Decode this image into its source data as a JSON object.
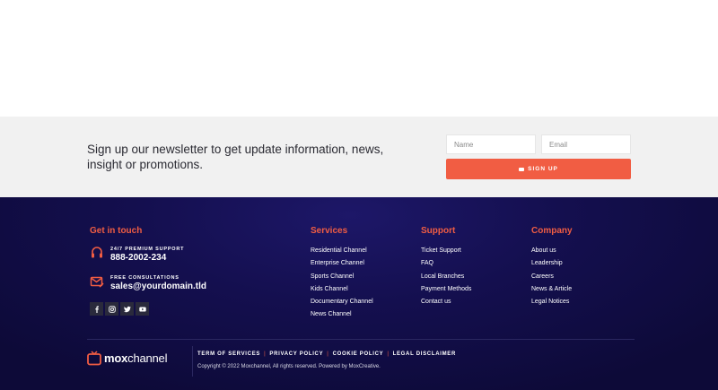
{
  "newsletter": {
    "text": "Sign up our newsletter to get update information, news, insight or promotions.",
    "name_placeholder": "Name",
    "email_placeholder": "Email",
    "button_label": "SIGN UP"
  },
  "get_in_touch": {
    "heading": "Get in touch",
    "support_label": "24/7 PREMIUM SUPPORT",
    "support_value": "888-2002-234",
    "consult_label": "FREE CONSULTATIONS",
    "consult_value": "sales@yourdomain.tld",
    "social_icons": [
      "facebook-icon",
      "instagram-icon",
      "twitter-icon",
      "youtube-icon"
    ]
  },
  "services": {
    "heading": "Services",
    "items": [
      "Residential Channel",
      "Enterprise Channel",
      "Sports Channel",
      "Kids Channel",
      "Documentary Channel",
      "News Channel"
    ]
  },
  "support": {
    "heading": "Support",
    "items": [
      "Ticket Support",
      "FAQ",
      "Local Branches",
      "Payment Methods",
      "Contact us"
    ]
  },
  "company": {
    "heading": "Company",
    "items": [
      "About us",
      "Leadership",
      "Careers",
      "News & Article",
      "Legal Notices"
    ]
  },
  "bottom": {
    "logo_bold": "mox",
    "logo_regular": "channel",
    "legal_links": [
      "TERM OF SERVICES",
      "PRIVACY POLICY",
      "COOKIE POLICY",
      "LEGAL DISCLAIMER"
    ],
    "copyright": "Copyright © 2022 Moxchannel, All rights reserved. Powered by MoxCreative."
  },
  "colors": {
    "accent": "#f15d43",
    "footer_bg": "#140f4f",
    "newsletter_bg": "#f1f1f1"
  }
}
